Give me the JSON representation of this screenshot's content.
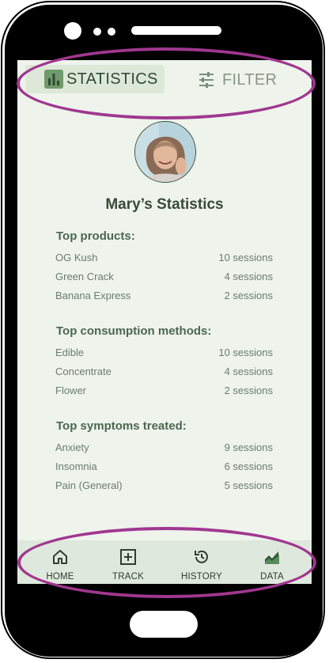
{
  "tabs": {
    "statistics_label": "STATISTICS",
    "filter_label": "FILTER"
  },
  "profile": {
    "title": "Mary’s Statistics"
  },
  "sections": [
    {
      "title": "Top products:",
      "rows": [
        {
          "name": "OG Kush",
          "value": "10 sessions"
        },
        {
          "name": "Green Crack",
          "value": "4 sessions"
        },
        {
          "name": "Banana Express",
          "value": "2 sessions"
        }
      ]
    },
    {
      "title": "Top consumption methods:",
      "rows": [
        {
          "name": "Edible",
          "value": "10 sessions"
        },
        {
          "name": "Concentrate",
          "value": "4 sessions"
        },
        {
          "name": "Flower",
          "value": "2 sessions"
        }
      ]
    },
    {
      "title": "Top symptoms treated:",
      "rows": [
        {
          "name": "Anxiety",
          "value": "9 sessions"
        },
        {
          "name": "Insomnia",
          "value": "6 sessions"
        },
        {
          "name": "Pain (General)",
          "value": "5 sessions"
        }
      ]
    }
  ],
  "nav": {
    "home": "HOME",
    "track": "TRACK",
    "history": "HISTORY",
    "data": "DATA"
  },
  "icons": {
    "statistics": "bar-chart-icon",
    "filter": "sliders-icon",
    "home": "home-icon",
    "track": "plus-square-icon",
    "history": "history-icon",
    "data": "area-chart-icon"
  },
  "colors": {
    "accent": "#a0378f",
    "screen_bg": "#eef3ec",
    "active_tab_bg": "#dde8d9",
    "text_dark": "#3a4a3a",
    "section_title": "#4d6552"
  }
}
